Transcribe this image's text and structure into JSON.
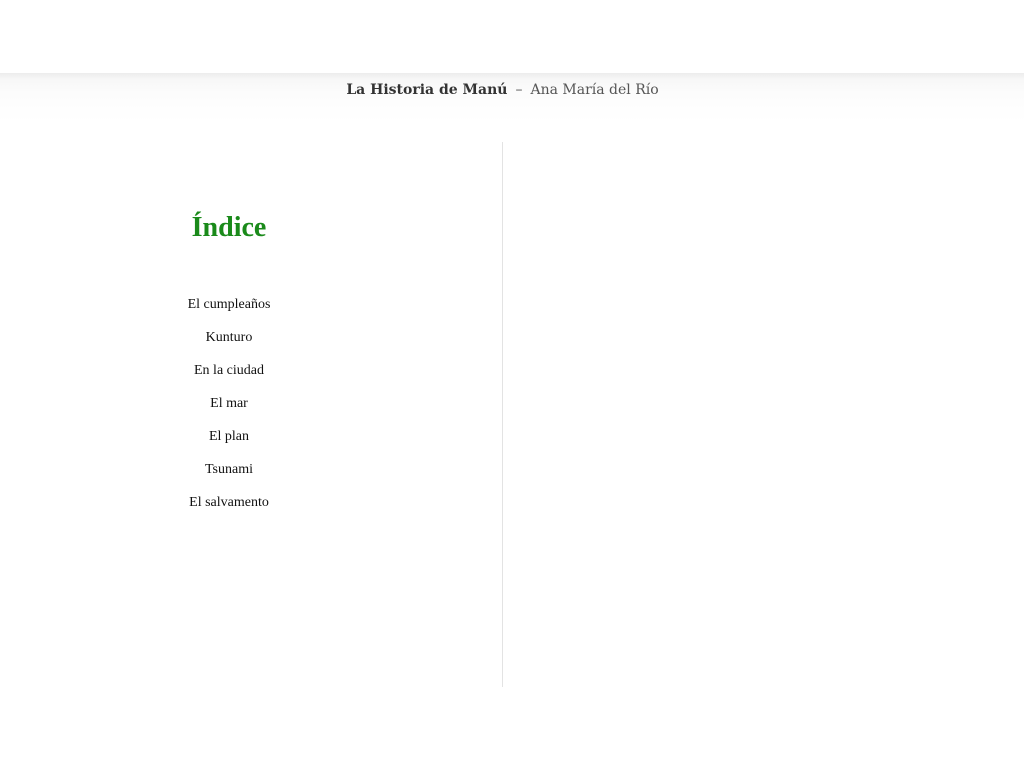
{
  "header": {
    "title": "La Historia de Manú",
    "separator": "–",
    "author": "Ana María del Río"
  },
  "toc": {
    "heading": "Índice",
    "heading_color": "#1a8a1a",
    "items": [
      {
        "label": "El cumpleaños"
      },
      {
        "label": "Kunturo"
      },
      {
        "label": "En la ciudad"
      },
      {
        "label": "El mar"
      },
      {
        "label": "El plan"
      },
      {
        "label": "Tsunami"
      },
      {
        "label": "El salvamento"
      }
    ]
  }
}
